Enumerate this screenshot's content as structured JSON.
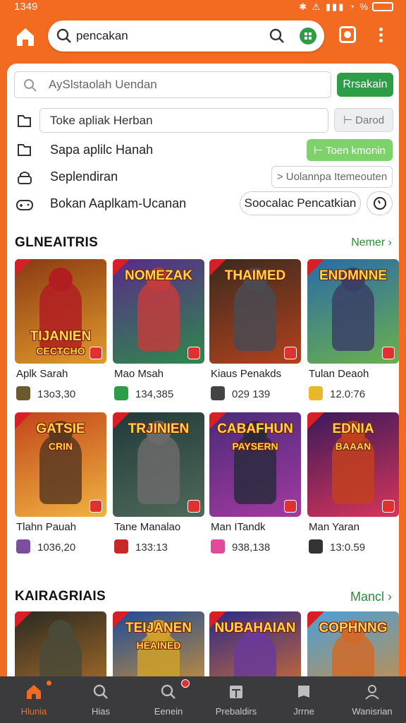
{
  "status_bar": {
    "time": "1349",
    "icons": "✱ ⚠ ▮▮▮ ◔ %"
  },
  "search": {
    "query": "pencakan"
  },
  "filters": {
    "row1": {
      "placeholder": "AySlstaolah Uendan",
      "button": "Rrsakain"
    },
    "row2": {
      "field": "Toke apliak Herban",
      "button": "⊢ Darod"
    },
    "row3": {
      "label": "Sapa aplilc Hanah",
      "button": "⊢ Toen kmonin"
    },
    "row4": {
      "label": "Seplendiran",
      "button": "> Uolannpa Itemeouten"
    },
    "row5": {
      "label": "Bokan Aaplkam-Ucanan",
      "button": "Soocalac Pencatkian"
    }
  },
  "sections": [
    {
      "title": "GLNEAITRIS",
      "more": "Nemer",
      "cards": [
        {
          "thumb_title": "TIJANIEN",
          "thumb_sub": "CECTCHO",
          "name": "Aplk Sarah",
          "meta": "13o3,30",
          "bg": "#8a3a12",
          "bg2": "#e39a2c",
          "hero": "#b21d22",
          "icon_color": "#6b5a2c"
        },
        {
          "thumb_title": "NOMEZAK",
          "thumb_sub": "",
          "name": "Mao Msah",
          "meta": "134,385",
          "bg": "#5a2a8a",
          "bg2": "#2d8a4b",
          "hero": "#c23c3c",
          "icon_color": "#2e9d48"
        },
        {
          "thumb_title": "THAIMED",
          "thumb_sub": "",
          "name": "Kiaus Penakds",
          "meta": "029 139",
          "bg": "#3a2a1e",
          "bg2": "#b3421d",
          "hero": "#4a4a52",
          "icon_color": "#444444"
        },
        {
          "thumb_title": "ENDMNNE",
          "thumb_sub": "",
          "name": "Tulan Deaoh",
          "meta": "12.0:76",
          "bg": "#2a6aa8",
          "bg2": "#6ab04c",
          "hero": "#3b3f66",
          "icon_color": "#e6b82a"
        }
      ]
    },
    {
      "title": "",
      "more": "",
      "cards": [
        {
          "thumb_title": "GATSIE",
          "thumb_sub": "CRIN",
          "name": "Tlahn Pauah",
          "meta": "1036,20",
          "bg": "#c2461a",
          "bg2": "#f0b341",
          "hero": "#5a3a22",
          "icon_color": "#7a4fa0"
        },
        {
          "thumb_title": "TRJINIEN",
          "thumb_sub": "",
          "name": "Tane Manalao",
          "meta": "133:13",
          "bg": "#213a3a",
          "bg2": "#4f6a5a",
          "hero": "#6a6a6a",
          "icon_color": "#c82828"
        },
        {
          "thumb_title": "CABAFHUN",
          "thumb_sub": "PAYSERN",
          "name": "Man ITandk",
          "meta": "938,138",
          "bg": "#4a2a7a",
          "bg2": "#a33aa0",
          "hero": "#2a2a3e",
          "icon_color": "#e04a9a"
        },
        {
          "thumb_title": "EDNIA",
          "thumb_sub": "BAAAN",
          "name": "Man Yaran",
          "meta": "13:0.59",
          "bg": "#3a1a5a",
          "bg2": "#d8345a",
          "hero": "#c2401e",
          "icon_color": "#333333"
        }
      ]
    },
    {
      "title": "KAIRAGRIAIS",
      "more": "Mancl",
      "cards": [
        {
          "thumb_title": "",
          "thumb_sub": "",
          "name": "",
          "meta": "",
          "bg": "#2a2a22",
          "bg2": "#c27a2a",
          "hero": "#4a4a38",
          "icon_color": "#444444"
        },
        {
          "thumb_title": "TEIJANEN",
          "thumb_sub": "HEAINED",
          "name": "",
          "meta": "",
          "bg": "#1d4a9a",
          "bg2": "#f0a020",
          "hero": "#d0a02a",
          "icon_color": "#444444"
        },
        {
          "thumb_title": "NUBAHAIAN",
          "thumb_sub": "",
          "name": "",
          "meta": "",
          "bg": "#2a2a8a",
          "bg2": "#f07a20",
          "hero": "#6a3a9a",
          "icon_color": "#444444"
        },
        {
          "thumb_title": "COPHNNG",
          "thumb_sub": "",
          "name": "",
          "meta": "",
          "bg": "#4aa0d8",
          "bg2": "#e08a2a",
          "hero": "#d06a2a",
          "icon_color": "#444444"
        }
      ]
    }
  ],
  "bottom_nav": [
    {
      "label": "Hlunia",
      "icon": "home-icon"
    },
    {
      "label": "Hias",
      "icon": "search-icon"
    },
    {
      "label": "Eenein",
      "icon": "search-icon"
    },
    {
      "label": "Prebaldirs",
      "icon": "store-icon"
    },
    {
      "label": "Jrrne",
      "icon": "book-icon"
    },
    {
      "label": "Wanisrian",
      "icon": "person-icon"
    }
  ],
  "colors": {
    "brand": "#f36b21",
    "accent": "#2e9d48",
    "nav_bg": "#3b3b3d"
  }
}
